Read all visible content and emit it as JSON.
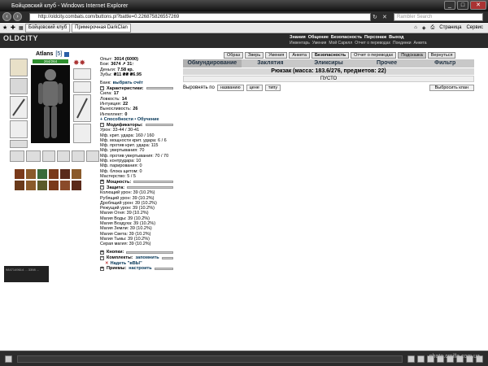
{
  "window": {
    "title": "Бойцовский клуб - Windows Internet Explorer"
  },
  "address": {
    "url": "http://oldcity.combats.com/buttons.pl?battle=0.226875826557269",
    "search_placeholder": "Rambler Search"
  },
  "tabs": [
    {
      "label": "Бойцовский клуб"
    },
    {
      "label": "Примерочная DarkClan"
    }
  ],
  "ie_tools": {
    "page_label": "Страница",
    "service_label": "Сервис"
  },
  "game": {
    "logo": "OLDCITY",
    "top_menu": [
      "Знания",
      "Общение",
      "Безопасность",
      "Персонаж",
      "Выход"
    ],
    "sub_menu": [
      "Инвентарь",
      "Умения",
      "Мой Сарелл",
      "Отчет о переводах",
      "Поединки",
      "Анкета"
    ],
    "toolbar": [
      "Образ",
      "Зверь",
      "Умения",
      "Анкета",
      "Безопасность",
      "Отчет о переводах",
      "Подсказка",
      "Вернуться"
    ],
    "character": {
      "name": "Atlans",
      "level": "[5]",
      "hp": "264/264"
    },
    "stats": [
      {
        "label": "Опыт:",
        "value": "3014 (6000)"
      },
      {
        "label": "Бои:",
        "value": "3674 ↗ 31↑"
      },
      {
        "label": "Деньги:",
        "value": "7.58 кр."
      },
      {
        "label": "Зубы:",
        "value": "₴11 ₴₴ ₴6.95"
      }
    ],
    "bank_label": "Банк:",
    "bank_link": "выбрать счёт",
    "characteristics_header": "Характеристики:",
    "characteristics": [
      {
        "label": "Сила:",
        "value": "17"
      },
      {
        "label": "Ловкость:",
        "value": "14"
      },
      {
        "label": "Интуиция:",
        "value": "22"
      },
      {
        "label": "Выносливость:",
        "value": "26"
      },
      {
        "label": "Интеллект:",
        "value": "0"
      }
    ],
    "abilities_link": "+ Способности • Обучение",
    "modifiers_header": "Модификаторы:",
    "modifiers": [
      "Урон: 33-44 / 30-41",
      "Мф. крит. удара: 160 / 160",
      "Мф. мощности крит. удара: 6 / 6",
      "Мф. против крит. удара: 115",
      "Мф. увертывания: 70",
      "Мф. против увертывания: 70 / 70",
      "Мф. контрудара: 10",
      "Мф. парирования: 0",
      "Мф. блока щитом: 0",
      "Мастерство: 5 / 5"
    ],
    "power_header": "Мощность:",
    "defense_header": "Защита:",
    "defense": [
      "Колющий урон: 39 (10.2%)",
      "Рубящий урон: 39 (10.2%)",
      "Дробящий урон: 39 (10.2%)",
      "Режущий урон: 39 (10.2%)",
      "Магия Огня: 39 (10.2%)",
      "Магия Воды: 39 (10.2%)",
      "Магия Воздуха: 39 (10.2%)",
      "Магия Земли: 39 (10.2%)",
      "Магия Света: 39 (10.2%)",
      "Магия Тьмы: 39 (10.2%)",
      "Серая магия: 39 (10.2%)"
    ],
    "buttons_header": "Кнопки:",
    "sets_header": "Комплекты:",
    "sets_remember": "запомнить",
    "set_item": "Надеть \"вВЫ\"",
    "tricks_header": "Приемы:",
    "tricks_link": "настроить",
    "inventory": {
      "tabs": [
        "Обмундирование",
        "Заклятия",
        "Эликсиры",
        "Прочее",
        "Фильтр"
      ],
      "title": "Рюкзак (масса: 183.6/276, предметов: 22)",
      "empty": "ПУСТО",
      "sort_label": "Выровнять по",
      "sort_buttons": [
        "названию",
        "цене",
        "типу"
      ],
      "clan_button": "Выбросить клан"
    },
    "badge_text": "9847149614 ... 3398 ..."
  },
  "statusbar": {
    "watermark": "photo.cmilla.com.ua"
  }
}
